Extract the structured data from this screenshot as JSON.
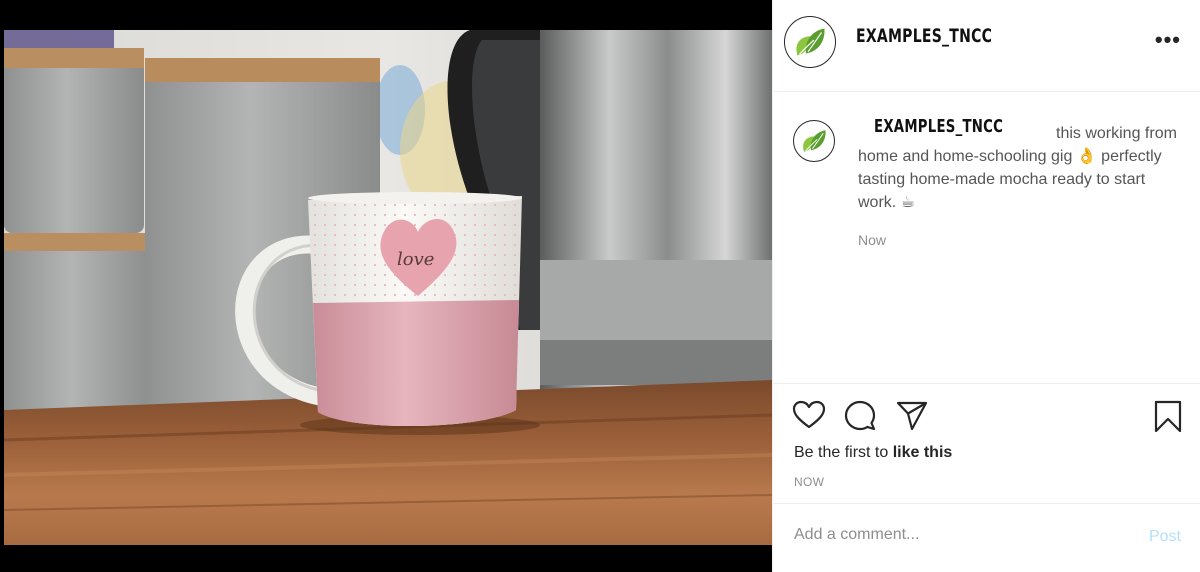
{
  "post": {
    "username": "EXAMPLES_TNCC",
    "more_icon": "more-horizontal-icon",
    "more_label": "•••"
  },
  "caption": {
    "username": "EXAMPLES_TNCC",
    "text_1": "this working from home and home-schooling gig",
    "emoji_1": "👌",
    "text_2": " perfectly tasting home-made mocha ready to start work. ",
    "emoji_2": "☕",
    "time": "Now"
  },
  "actions": {
    "icons": [
      "heart-icon",
      "comment-icon",
      "share-icon",
      "bookmark-icon"
    ],
    "likes_prefix": "Be the first to ",
    "likes_bold": "like this",
    "post_time": "NOW"
  },
  "comment": {
    "placeholder": "Add a comment...",
    "post_label": "Post"
  },
  "colors": {
    "brand_leaf_light": "#8cc63f",
    "brand_leaf_dark": "#5a9e2f",
    "post_button_disabled": "#b2dffc",
    "muted_text": "#8e8e8e"
  }
}
